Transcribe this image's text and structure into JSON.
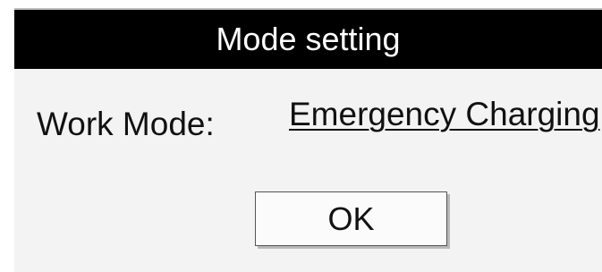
{
  "dialog": {
    "title": "Mode setting",
    "work_mode_label": "Work Mode:",
    "work_mode_value": "Emergency Charging",
    "ok_label": "OK"
  }
}
